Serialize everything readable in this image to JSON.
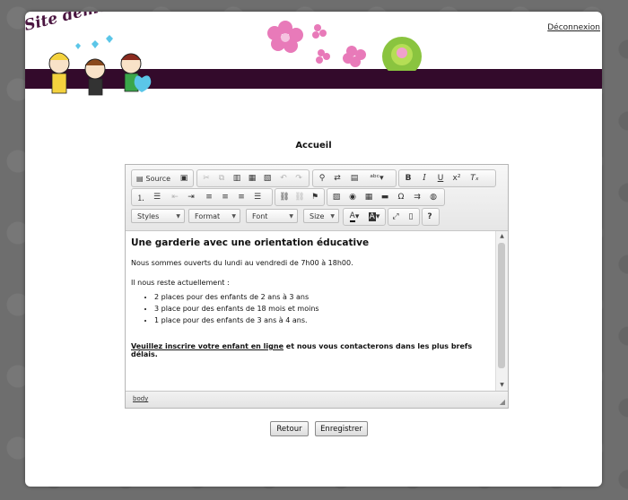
{
  "header": {
    "site_title": "Site démonstrateur",
    "logout_label": "Déconnexion",
    "logo_icon": "children-drawing-icon",
    "decor_icon": "flowers-icon"
  },
  "page": {
    "heading": "Accueil"
  },
  "toolbar": {
    "source_label": "Source",
    "styles_label": "Styles",
    "format_label": "Format",
    "font_label": "Font",
    "size_label": "Size"
  },
  "content": {
    "heading": "Une garderie avec une orientation éducative",
    "opening": "Nous sommes ouverts du lundi au vendredi de 7h00 à 18h00.",
    "remaining_intro": "Il nous reste actuellement :",
    "items": [
      "2 places pour des enfants de 2 ans à 3 ans",
      "3 place pour des enfants de 18 mois et moins",
      "1 place pour des enfants de 3 ans à 4 ans."
    ],
    "link_text": "Veuillez inscrire votre enfant en ligne",
    "closing_text": " et nous vous contacterons dans les plus brefs délais."
  },
  "status": {
    "path": "body"
  },
  "actions": {
    "back_label": "Retour",
    "save_label": "Enregistrer"
  },
  "colors": {
    "banner": "#330a2b",
    "title": "#4a1540",
    "background": "#6e6e6e"
  }
}
